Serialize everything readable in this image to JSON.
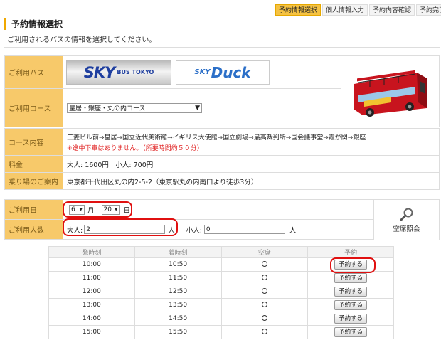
{
  "steps": [
    "予約情報選択",
    "個人情報入力",
    "予約内容確認",
    "予約完了"
  ],
  "page_title": "予約情報選択",
  "subtitle": "ご利用されるバスの情報を選択してください。",
  "bus": {
    "label": "ご利用バス",
    "sky_logo": "SKY",
    "sky_logo_sub": "BUS TOKYO",
    "duck_logo_small": "SKY",
    "duck_logo_big": "Duck"
  },
  "course": {
    "label": "ご利用コース",
    "selected": "皇居・銀座・丸の内コース"
  },
  "course_detail": {
    "label": "コース内容",
    "route": "三菱ビル前⇒皇居⇒国立近代美術館⇒イギリス大使館⇒国立劇場⇒最高裁判所⇒国会議事堂⇒霞が関⇒銀座",
    "note": "※途中下車はありません。（所要時間約５０分）"
  },
  "price": {
    "label": "料金",
    "value": "大人: 1600円　小人: 700円"
  },
  "boarding": {
    "label": "乗り場のご案内",
    "value": "東京都千代田区丸の内2-5-2（東京駅丸の内南口より徒歩3分）"
  },
  "date": {
    "label": "ご利用日",
    "month": "6",
    "month_unit": "月",
    "day": "20",
    "day_unit": "日"
  },
  "people": {
    "label": "ご利用人数",
    "adult_label": "大人:",
    "adult_value": "2",
    "adult_unit": "人",
    "child_label": "小人:",
    "child_value": "0",
    "child_unit": "人"
  },
  "availability_button": "空席照会",
  "schedule": {
    "headers": [
      "発時刻",
      "着時刻",
      "空席",
      "予約"
    ],
    "button_label": "予約する",
    "rows": [
      {
        "depart": "10:00",
        "arrive": "10:50"
      },
      {
        "depart": "11:00",
        "arrive": "11:50"
      },
      {
        "depart": "12:00",
        "arrive": "12:50"
      },
      {
        "depart": "13:00",
        "arrive": "13:50"
      },
      {
        "depart": "14:00",
        "arrive": "14:50"
      },
      {
        "depart": "15:00",
        "arrive": "15:50"
      }
    ]
  },
  "colors": {
    "accent": "#f5c242",
    "label_bg": "#f7c96a",
    "highlight": "#e01010"
  }
}
